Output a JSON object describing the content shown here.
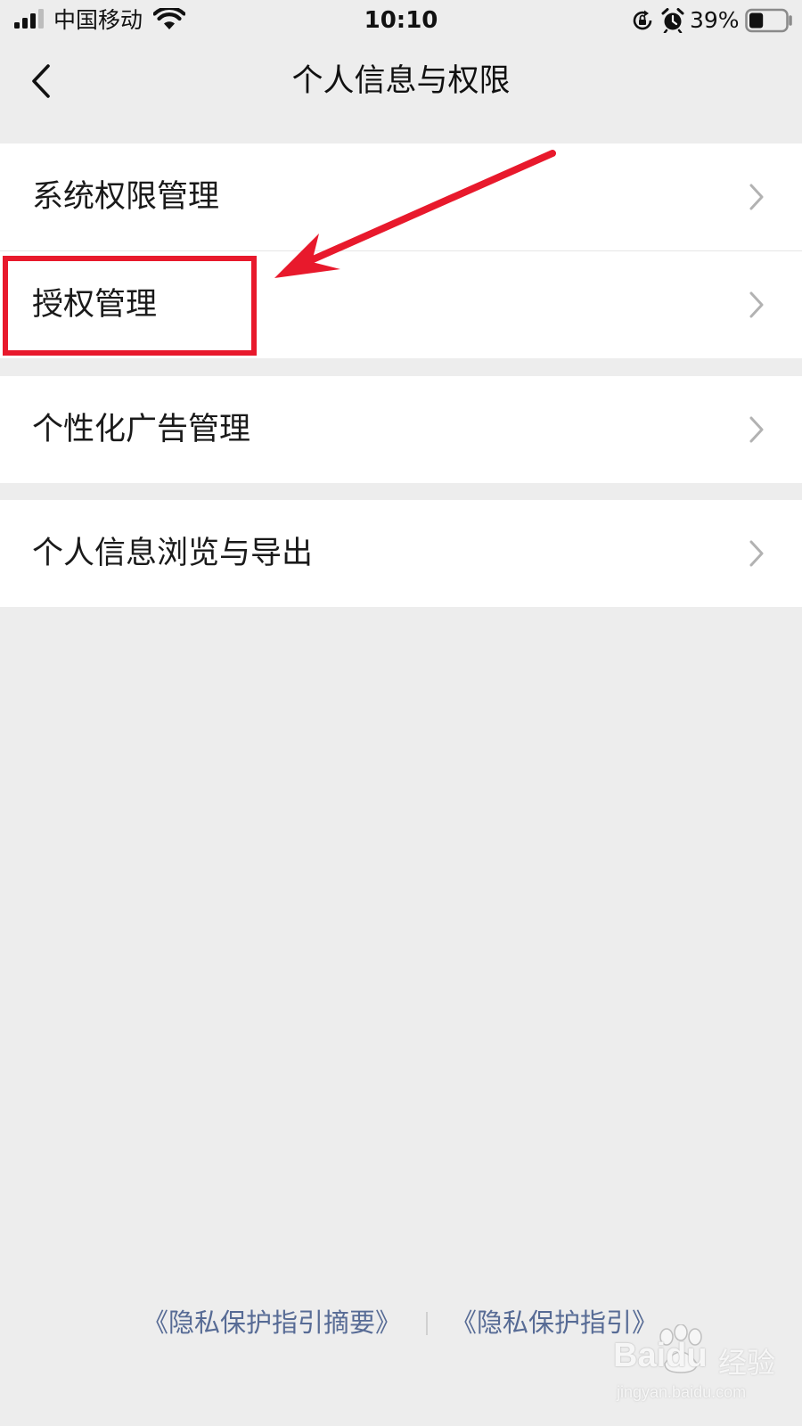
{
  "status_bar": {
    "carrier": "中国移动",
    "time": "10:10",
    "battery_percent": "39%",
    "battery_level": 0.39,
    "icons": [
      "signal-icon",
      "wifi-icon",
      "rotation-lock-icon",
      "alarm-icon",
      "battery-icon"
    ]
  },
  "nav": {
    "title": "个人信息与权限",
    "back_icon": "chevron-left-icon"
  },
  "menu": {
    "items": [
      {
        "label": "系统权限管理"
      },
      {
        "label": "授权管理"
      },
      {
        "label": "个性化广告管理"
      },
      {
        "label": "个人信息浏览与导出"
      }
    ],
    "chevron_icon": "chevron-right-icon"
  },
  "footer": {
    "link_summary": "《隐私保护指引摘要》",
    "link_full": "《隐私保护指引》"
  },
  "watermark": {
    "brand": "Baidu",
    "sub": "经验",
    "url": "jingyan.baidu.com"
  },
  "colors": {
    "background": "#ededed",
    "card": "#ffffff",
    "link": "#576b95",
    "annotation": "#e8192c"
  }
}
